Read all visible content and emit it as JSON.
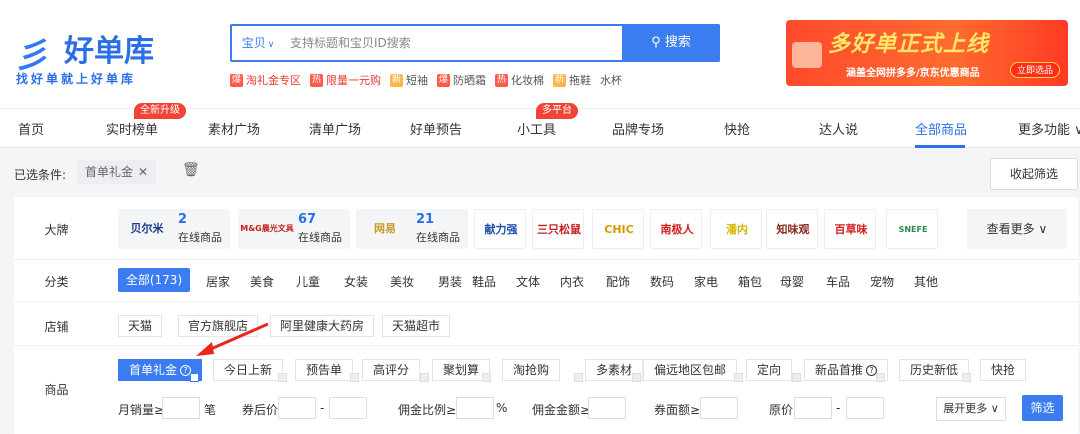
{
  "logo": {
    "mark": "彡",
    "name": "好单库",
    "slogan": "找好单就上好单库"
  },
  "search": {
    "type": "宝贝",
    "placeholder": "支持标题和宝贝ID搜索",
    "button": "搜索"
  },
  "hot_tags": [
    {
      "badge": "爆",
      "text": "淘礼金专区",
      "badge_color": "red",
      "text_color": "red"
    },
    {
      "badge": "热",
      "text": "限量一元购",
      "badge_color": "red",
      "text_color": "red"
    },
    {
      "badge": "新",
      "text": "短袖",
      "badge_color": "orange",
      "text_color": ""
    },
    {
      "badge": "爆",
      "text": "防晒霜",
      "badge_color": "red",
      "text_color": ""
    },
    {
      "badge": "热",
      "text": "化妆棉",
      "badge_color": "red",
      "text_color": ""
    },
    {
      "badge": "新",
      "text": "拖鞋",
      "badge_color": "orange",
      "text_color": ""
    },
    {
      "badge": "",
      "text": "水杯",
      "badge_color": "",
      "text_color": ""
    }
  ],
  "banner": {
    "title": "多好单正式上线",
    "subtitle": "涵盖全网拼多多/京东优惠商品",
    "button": "立即选品"
  },
  "nav": {
    "items": [
      "首页",
      "实时榜单",
      "素材广场",
      "清单广场",
      "好单预告",
      "小工具",
      "品牌专场",
      "快抢",
      "达人说",
      "全部商品",
      "更多功能"
    ],
    "badge_realtime": "全新升级",
    "badge_tools": "多平台",
    "active_index": 9
  },
  "selected": {
    "label": "已选条件:",
    "tag": "首单礼金",
    "collapse": "收起筛选"
  },
  "rows": {
    "brand": "大牌",
    "category": "分类",
    "shop": "店铺",
    "goods": "商品"
  },
  "brands": [
    {
      "logo": "贝尔米",
      "count": "2",
      "status": "在线商品",
      "color": "#1a3a8a"
    },
    {
      "logo": "M&G晨光文具",
      "count": "67",
      "status": "在线商品",
      "color": "#c41f1f"
    },
    {
      "logo": "网易",
      "count": "21",
      "status": "在线商品",
      "color": "#c99a2a"
    },
    {
      "logo": "献力强",
      "color": "#1f4fb0"
    },
    {
      "logo": "三只松鼠",
      "color": "#c41f1f"
    },
    {
      "logo": "CHIC",
      "color": "#d49a00"
    },
    {
      "logo": "南极人",
      "color": "#d41f1f"
    },
    {
      "logo": "潘内",
      "color": "#d4b600"
    },
    {
      "logo": "知味观",
      "color": "#8a2a1f"
    },
    {
      "logo": "百草味",
      "color": "#d41f1f"
    },
    {
      "logo": "SNEFE",
      "color": "#2a8a4a"
    }
  ],
  "brand_more": "查看更多",
  "categories": {
    "all": "全部(173)",
    "items": [
      "居家",
      "美食",
      "儿童",
      "女装",
      "美妆",
      "男装",
      "鞋品",
      "文体",
      "内衣",
      "配饰",
      "数码",
      "家电",
      "箱包",
      "母婴",
      "车品",
      "宠物",
      "其他"
    ]
  },
  "shops": [
    "天猫",
    "官方旗舰店",
    "阿里健康大药房",
    "天猫超市"
  ],
  "goods": [
    "首单礼金",
    "今日上新",
    "预告单",
    "高评分",
    "聚划算",
    "淘抢购",
    "多素材",
    "偏远地区包邮",
    "定向",
    "新品首推",
    "历史新低",
    "快抢"
  ],
  "inputs": {
    "monthly_sales": "月销量≥",
    "unit_pieces": "笔",
    "after_coupon": "券后价",
    "dash": "-",
    "commission": "佣金比例≥",
    "percent": "%",
    "commission_amount": "佣金金额≥",
    "coupon_amount": "券面额≥",
    "original_price": "原价",
    "expand": "展开更多",
    "filter": "筛选"
  },
  "colors": {
    "primary": "#3b7df0",
    "badge_red": "#f04436",
    "arrow": "#e8281e"
  }
}
